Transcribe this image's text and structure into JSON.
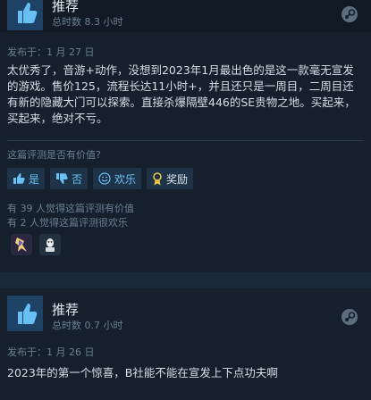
{
  "reviews": [
    {
      "recommendation": "推荐",
      "hours": "总时数 8.3 小时",
      "posted": "发布于：1 月 27 日",
      "text": "太优秀了，音游+动作，没想到2023年1月最出色的是这一款毫无宣发的游戏。售价125，流程长达11小时+，并且还只是一周目，二周目还有新的隐藏大门可以探索。直接杀爆隔壁446的SE贵物之地。买起来，买起来，绝对不亏。",
      "helpful_question": "这篇评测是否有价值?",
      "buttons": {
        "yes": "是",
        "no": "否",
        "funny": "欢乐",
        "award": "奖励"
      },
      "stats": {
        "helpful": "有 39 人觉得这篇评测有价值",
        "funny": "有 2 人觉得这篇评测很欢乐"
      },
      "awards": [
        "award-icon-1",
        "award-icon-2"
      ]
    },
    {
      "recommendation": "推荐",
      "hours": "总时数 0.7 小时",
      "posted": "发布于：1 月 26 日",
      "text": "2023年的第一个惊喜，B社能不能在宣发上下点功夫啊"
    }
  ],
  "colors": {
    "background": "#1b2838",
    "card": "#16202d",
    "accent_blue": "#67c1f5",
    "award_gold": "#e8c546"
  }
}
